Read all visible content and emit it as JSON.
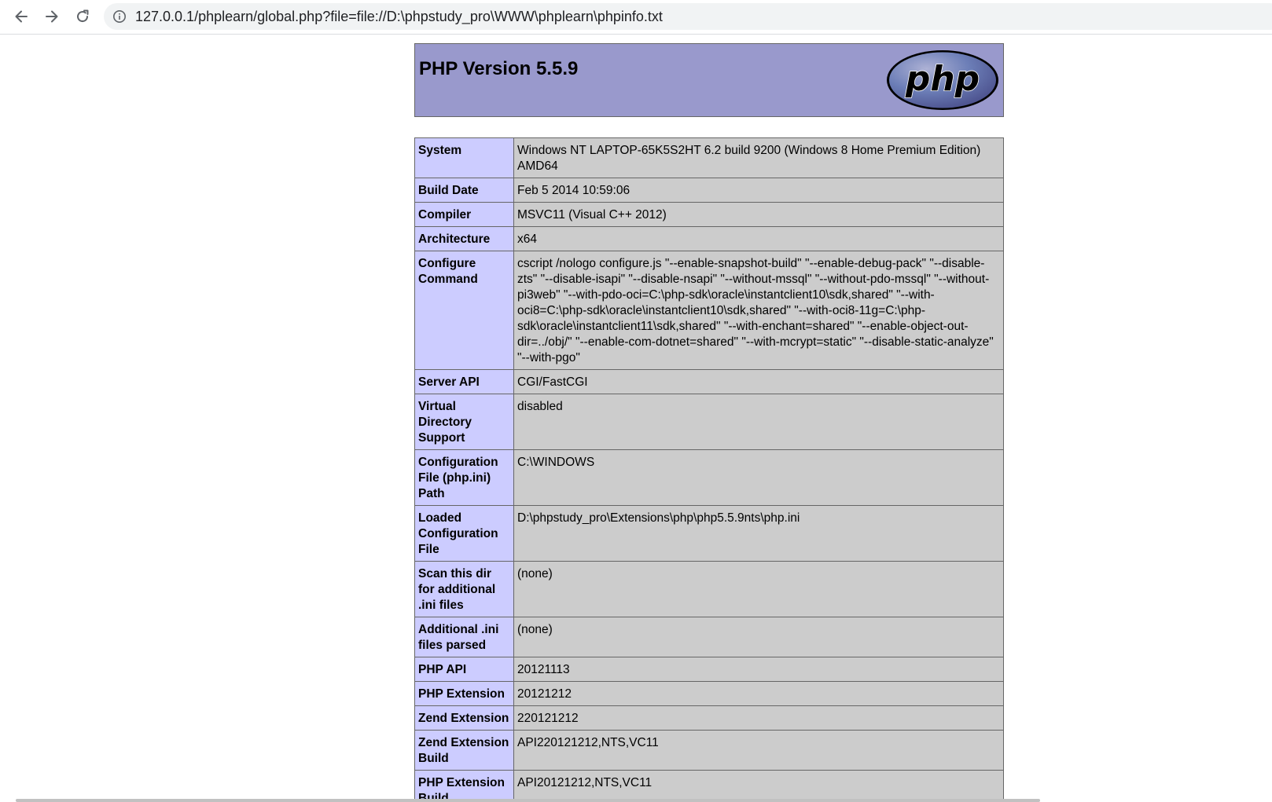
{
  "browser": {
    "url": "127.0.0.1/phplearn/global.php?file=file://D:\\phpstudy_pro\\WWW\\phplearn\\phpinfo.txt"
  },
  "phpinfo": {
    "title": "PHP Version 5.5.9",
    "logo_text": "php",
    "rows": [
      {
        "key": "System",
        "value": "Windows NT LAPTOP-65K5S2HT 6.2 build 9200 (Windows 8 Home Premium Edition) AMD64"
      },
      {
        "key": "Build Date",
        "value": "Feb 5 2014 10:59:06"
      },
      {
        "key": "Compiler",
        "value": "MSVC11 (Visual C++ 2012)"
      },
      {
        "key": "Architecture",
        "value": "x64"
      },
      {
        "key": "Configure Command",
        "value": "cscript /nologo configure.js \"--enable-snapshot-build\" \"--enable-debug-pack\" \"--disable-zts\" \"--disable-isapi\" \"--disable-nsapi\" \"--without-mssql\" \"--without-pdo-mssql\" \"--without-pi3web\" \"--with-pdo-oci=C:\\php-sdk\\oracle\\instantclient10\\sdk,shared\" \"--with-oci8=C:\\php-sdk\\oracle\\instantclient10\\sdk,shared\" \"--with-oci8-11g=C:\\php-sdk\\oracle\\instantclient11\\sdk,shared\" \"--with-enchant=shared\" \"--enable-object-out-dir=../obj/\" \"--enable-com-dotnet=shared\" \"--with-mcrypt=static\" \"--disable-static-analyze\" \"--with-pgo\""
      },
      {
        "key": "Server API",
        "value": "CGI/FastCGI"
      },
      {
        "key": "Virtual Directory Support",
        "value": "disabled"
      },
      {
        "key": "Configuration File (php.ini) Path",
        "value": "C:\\WINDOWS"
      },
      {
        "key": "Loaded Configuration File",
        "value": "D:\\phpstudy_pro\\Extensions\\php\\php5.5.9nts\\php.ini"
      },
      {
        "key": "Scan this dir for additional .ini files",
        "value": "(none)"
      },
      {
        "key": "Additional .ini files parsed",
        "value": "(none)"
      },
      {
        "key": "PHP API",
        "value": "20121113"
      },
      {
        "key": "PHP Extension",
        "value": "20121212"
      },
      {
        "key": "Zend Extension",
        "value": "220121212"
      },
      {
        "key": "Zend Extension Build",
        "value": "API220121212,NTS,VC11"
      },
      {
        "key": "PHP Extension Build",
        "value": "API20121212,NTS,VC11"
      }
    ]
  }
}
